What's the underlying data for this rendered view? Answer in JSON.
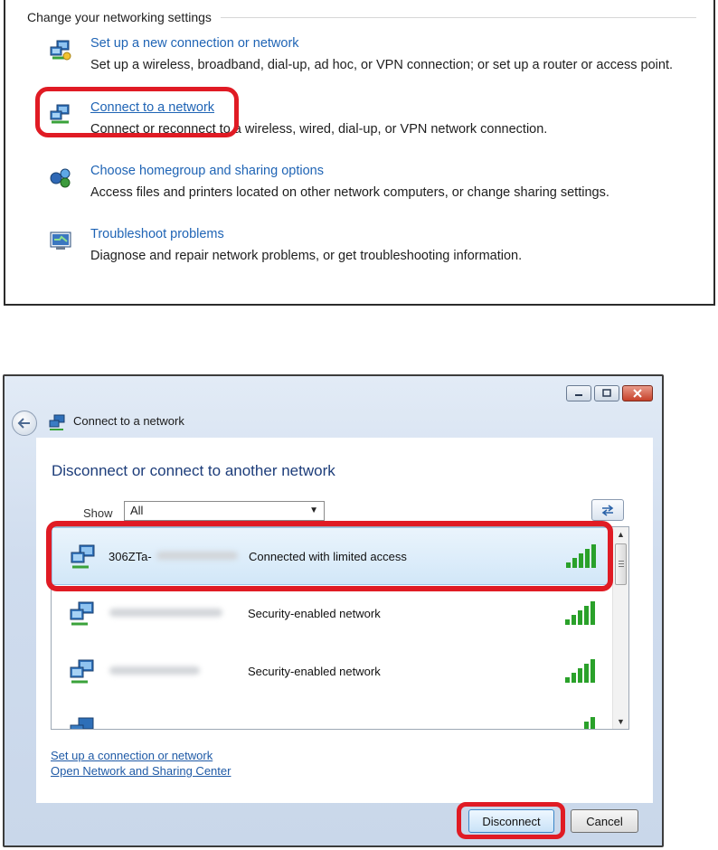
{
  "settings_panel": {
    "title": "Change your networking settings",
    "tasks": [
      {
        "icon": "new-connection-icon",
        "link": "Set up a new connection or network",
        "description": "Set up a wireless, broadband, dial-up, ad hoc, or VPN connection; or set up a router or access point."
      },
      {
        "icon": "connect-network-icon",
        "link": "Connect to a network",
        "description": "Connect or reconnect to a wireless, wired, dial-up, or VPN network connection.",
        "visible_description": "Connect or reconnect to a wireless, wired, dial-up, or VPN network connection."
      },
      {
        "icon": "homegroup-icon",
        "link": "Choose homegroup and sharing options",
        "description": "Access files and printers located on other network computers, or change sharing settings."
      },
      {
        "icon": "troubleshoot-icon",
        "link": "Troubleshoot problems",
        "description": "Diagnose and repair network problems, or get troubleshooting information."
      }
    ]
  },
  "dialog": {
    "window_title": "Connect to a network",
    "heading": "Disconnect or connect to another network",
    "show_label": "Show",
    "show_value": "All",
    "networks": [
      {
        "ssid": "306ZTa-",
        "status": "Connected with limited access",
        "selected": true
      },
      {
        "ssid": "",
        "status": "Security-enabled network",
        "selected": false
      },
      {
        "ssid": "",
        "status": "Security-enabled network",
        "selected": false
      }
    ],
    "links": {
      "setup": "Set up a connection or network",
      "sharing_center": "Open Network and Sharing Center"
    },
    "buttons": {
      "disconnect": "Disconnect",
      "cancel": "Cancel"
    }
  },
  "colors": {
    "highlight": "#e01b24",
    "link": "#1f64b5",
    "signal": "#2aa12a"
  }
}
